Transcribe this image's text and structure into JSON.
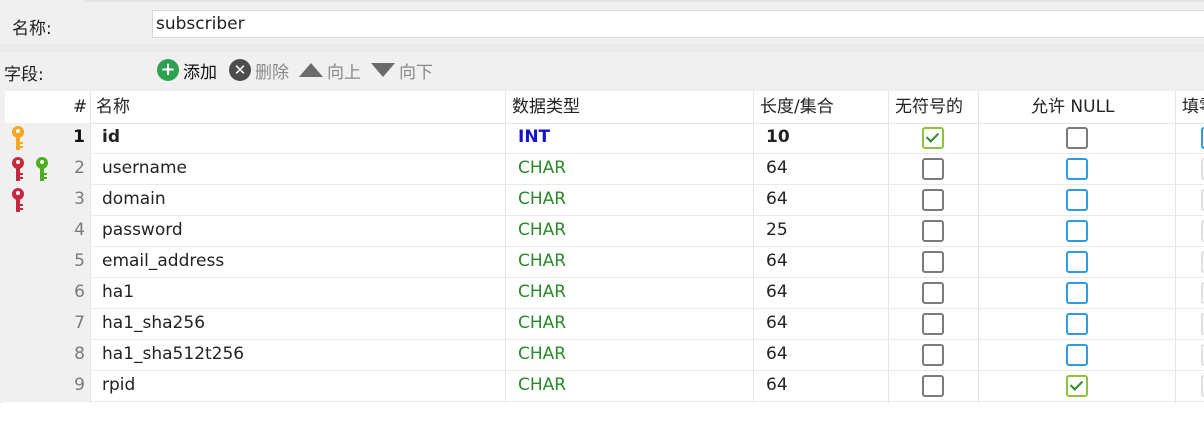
{
  "name_label": "名称:",
  "table_name": "subscriber",
  "fields_label": "字段:",
  "toolbar": {
    "add": "添加",
    "delete": "删除",
    "up": "向上",
    "down": "向下"
  },
  "columns": {
    "num": "#",
    "name": "名称",
    "type": "数据类型",
    "length": "长度/集合",
    "unsigned": "无符号的",
    "nullable": "允许 NULL",
    "fill": "填零"
  },
  "rows": [
    {
      "num": "1",
      "name": "id",
      "type": "INT",
      "length": "10",
      "unsigned": true,
      "nullable": false,
      "keys": [
        "primary-key"
      ]
    },
    {
      "num": "2",
      "name": "username",
      "type": "CHAR",
      "length": "64",
      "unsigned": false,
      "nullable": false,
      "keys": [
        "unique-key",
        "index-key"
      ]
    },
    {
      "num": "3",
      "name": "domain",
      "type": "CHAR",
      "length": "64",
      "unsigned": false,
      "nullable": false,
      "keys": [
        "unique-key"
      ]
    },
    {
      "num": "4",
      "name": "password",
      "type": "CHAR",
      "length": "25",
      "unsigned": false,
      "nullable": false,
      "keys": []
    },
    {
      "num": "5",
      "name": "email_address",
      "type": "CHAR",
      "length": "64",
      "unsigned": false,
      "nullable": false,
      "keys": []
    },
    {
      "num": "6",
      "name": "ha1",
      "type": "CHAR",
      "length": "64",
      "unsigned": false,
      "nullable": false,
      "keys": []
    },
    {
      "num": "7",
      "name": "ha1_sha256",
      "type": "CHAR",
      "length": "64",
      "unsigned": false,
      "nullable": false,
      "keys": []
    },
    {
      "num": "8",
      "name": "ha1_sha512t256",
      "type": "CHAR",
      "length": "64",
      "unsigned": false,
      "nullable": false,
      "keys": []
    },
    {
      "num": "9",
      "name": "rpid",
      "type": "CHAR",
      "length": "64",
      "unsigned": false,
      "nullable": true,
      "keys": []
    }
  ],
  "colors": {
    "int_type": "#1515d0",
    "char_type": "#2a8a2a",
    "primary_key": "#f5a623",
    "unique_key": "#c8283c",
    "index_key": "#4caf1e",
    "checkbox_blue": "#2f9be6",
    "checkbox_green": "#8cc33e"
  }
}
